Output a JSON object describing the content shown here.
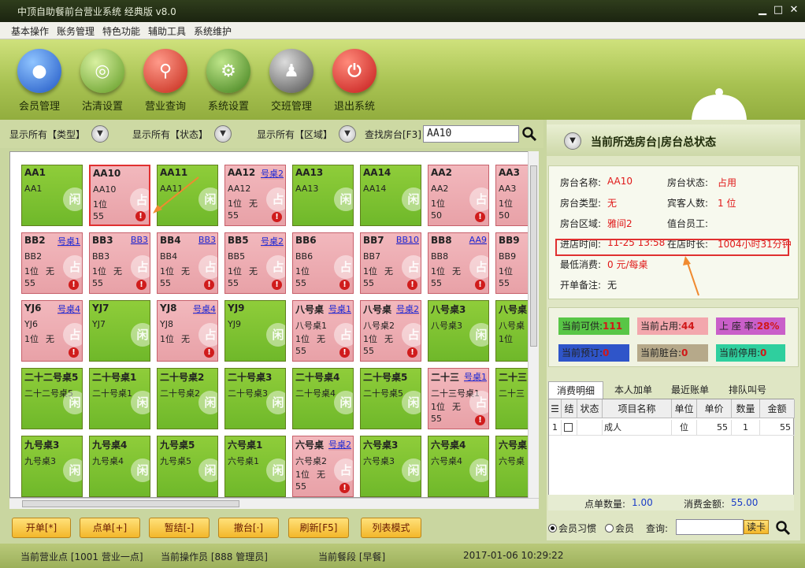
{
  "window": {
    "title": "中顶自助餐前台营业系统 经典版 v8.0"
  },
  "menu": [
    "基本操作",
    "账务管理",
    "特色功能",
    "辅助工具",
    "系统维护"
  ],
  "toolbar": [
    {
      "label": "会员管理",
      "icon": "person-icon",
      "color": "#2f6fd6"
    },
    {
      "label": "沽清设置",
      "icon": "plate-icon",
      "color": "#7db33a"
    },
    {
      "label": "营业查询",
      "icon": "magnifier-icon",
      "color": "#d63a2a"
    },
    {
      "label": "系统设置",
      "icon": "gear-icon",
      "color": "#5a9a2a"
    },
    {
      "label": "交班管理",
      "icon": "people-icon",
      "color": "#6a6a6a"
    },
    {
      "label": "退出系统",
      "icon": "power-icon",
      "color": "#d82a2a"
    }
  ],
  "filters": {
    "type": "显示所有【类型】",
    "status": "显示所有【状态】",
    "area": "显示所有【区域】",
    "search_label": "查找房台[F3]",
    "search_value": "AA10"
  },
  "rows": [
    [
      {
        "name": "AA1",
        "sub": "AA1",
        "state": "free",
        "icon": "闲"
      },
      {
        "name": "AA10",
        "sub": "AA10",
        "state": "busy",
        "people": "1位",
        "amount": "55",
        "icon": "占"
      },
      {
        "name": "AA11",
        "sub": "AA11",
        "state": "free",
        "icon": "闲"
      },
      {
        "name": "AA12",
        "link": "号桌2",
        "sub": "AA12",
        "state": "busy",
        "people": "1位",
        "extra": "无",
        "amount": "55",
        "icon": "占"
      },
      {
        "name": "AA13",
        "sub": "AA13",
        "state": "free",
        "icon": "闲"
      },
      {
        "name": "AA14",
        "sub": "AA14",
        "state": "free",
        "icon": "闲"
      },
      {
        "name": "AA2",
        "sub": "AA2",
        "state": "busy",
        "people": "1位",
        "amount": "50",
        "icon": "占"
      },
      {
        "name": "AA3",
        "sub": "AA3",
        "state": "busy",
        "people": "1位",
        "amount": "50",
        "icon": "占"
      }
    ],
    [
      {
        "name": "BB2",
        "link": "号桌1",
        "sub": "BB2",
        "state": "busy",
        "people": "1位",
        "extra": "无",
        "amount": "55",
        "icon": "占"
      },
      {
        "name": "BB3",
        "link": "BB3",
        "sub": "BB3",
        "state": "busy",
        "people": "1位",
        "extra": "无",
        "amount": "55",
        "icon": "占"
      },
      {
        "name": "BB4",
        "link": "BB3",
        "sub": "BB4",
        "state": "busy",
        "people": "1位",
        "extra": "无",
        "amount": "55",
        "icon": "占"
      },
      {
        "name": "BB5",
        "link": "号桌2",
        "sub": "BB5",
        "state": "busy",
        "people": "1位",
        "extra": "无",
        "amount": "55",
        "icon": "占"
      },
      {
        "name": "BB6",
        "sub": "BB6",
        "state": "busy",
        "people": "1位",
        "amount": "55",
        "icon": "占"
      },
      {
        "name": "BB7",
        "link": "BB10",
        "sub": "BB7",
        "state": "busy",
        "people": "1位",
        "extra": "无",
        "amount": "55",
        "icon": "占"
      },
      {
        "name": "BB8",
        "link": "AA9",
        "sub": "BB8",
        "state": "busy",
        "people": "1位",
        "extra": "无",
        "amount": "55",
        "icon": "占"
      },
      {
        "name": "BB9",
        "sub": "BB9",
        "state": "busy",
        "people": "1位",
        "amount": "55",
        "icon": "占"
      }
    ],
    [
      {
        "name": "YJ6",
        "link": "号桌4",
        "sub": "YJ6",
        "state": "busy",
        "people": "1位",
        "extra": "无",
        "icon": "占"
      },
      {
        "name": "YJ7",
        "sub": "YJ7",
        "state": "free",
        "icon": "闲"
      },
      {
        "name": "YJ8",
        "link": "号桌4",
        "sub": "YJ8",
        "state": "busy",
        "people": "1位",
        "extra": "无",
        "icon": "占"
      },
      {
        "name": "YJ9",
        "sub": "YJ9",
        "state": "free",
        "icon": "闲"
      },
      {
        "name": "八号桌",
        "link": "号桌1",
        "sub": "八号桌1",
        "state": "busy",
        "people": "1位",
        "extra": "无",
        "amount": "55",
        "icon": "占"
      },
      {
        "name": "八号桌",
        "link": "号桌2",
        "sub": "八号桌2",
        "state": "busy",
        "people": "1位",
        "extra": "无",
        "amount": "55",
        "icon": "占"
      },
      {
        "name": "八号桌3",
        "sub": "八号桌3",
        "state": "free",
        "icon": "闲"
      },
      {
        "name": "八号桌",
        "sub": "八号桌",
        "state": "free",
        "people": "1位",
        "icon": "闲"
      }
    ],
    [
      {
        "name": "二十二号桌5",
        "sub": "二十二号桌5",
        "state": "free",
        "icon": "闲"
      },
      {
        "name": "二十号桌1",
        "sub": "二十号桌1",
        "state": "free",
        "icon": "闲"
      },
      {
        "name": "二十号桌2",
        "sub": "二十号桌2",
        "state": "free",
        "icon": "闲"
      },
      {
        "name": "二十号桌3",
        "sub": "二十号桌3",
        "state": "free",
        "icon": "闲"
      },
      {
        "name": "二十号桌4",
        "sub": "二十号桌4",
        "state": "free",
        "icon": "闲"
      },
      {
        "name": "二十号桌5",
        "sub": "二十号桌5",
        "state": "free",
        "icon": "闲"
      },
      {
        "name": "二十三",
        "link": "号桌1",
        "sub": "二十三号桌1",
        "state": "busy",
        "people": "1位",
        "extra": "无",
        "amount": "55",
        "icon": "占"
      },
      {
        "name": "二十三",
        "sub": "二十三",
        "state": "free",
        "icon": "闲"
      }
    ],
    [
      {
        "name": "九号桌3",
        "sub": "九号桌3",
        "state": "free",
        "icon": "闲"
      },
      {
        "name": "九号桌4",
        "sub": "九号桌4",
        "state": "free",
        "icon": "闲"
      },
      {
        "name": "九号桌5",
        "sub": "九号桌5",
        "state": "free",
        "icon": "闲"
      },
      {
        "name": "六号桌1",
        "sub": "六号桌1",
        "state": "free",
        "icon": "闲"
      },
      {
        "name": "六号桌",
        "link": "号桌2",
        "sub": "六号桌2",
        "state": "busy",
        "people": "1位",
        "extra": "无",
        "amount": "55",
        "icon": "占"
      },
      {
        "name": "六号桌3",
        "sub": "六号桌3",
        "state": "free",
        "icon": "闲"
      },
      {
        "name": "六号桌4",
        "sub": "六号桌4",
        "state": "free",
        "icon": "闲"
      },
      {
        "name": "六号桌",
        "sub": "六号桌",
        "state": "free",
        "icon": "闲"
      }
    ]
  ],
  "bottom_buttons": [
    "开单[*]",
    "点单[+]",
    "暂结[-]",
    "撤台[·]",
    "刷新[F5]",
    "列表模式"
  ],
  "status": {
    "point": "当前营业点 [1001 营业一点]",
    "operator": "当前操作员 [888 管理员]",
    "period": "当前餐段 [早餐]",
    "datetime": "2017-01-06 10:29:22"
  },
  "panel": {
    "title": "当前所选房台|房台总状态",
    "labels": {
      "room_name": "房台名称:",
      "room_status": "房台状态:",
      "room_type": "房台类型:",
      "guests": "宾客人数:",
      "room_area": "房台区域:",
      "staff": "值台员工:",
      "entry_time": "进店时间:",
      "duration": "在店时长:",
      "min_consume": "最低消费:",
      "remark": "开单备注:"
    },
    "values": {
      "room_name": "AA10",
      "room_status": "占用",
      "room_type": "无",
      "guests": "1 位",
      "room_area": "雅间2",
      "entry_time": "11-25 13:58",
      "duration": "1004小时31分钟",
      "min_consume": "0 元/每桌",
      "remark": "无"
    },
    "stats": [
      {
        "label": "当前可供:",
        "value": "111",
        "bg": "#58c646"
      },
      {
        "label": "当前占用:",
        "value": "44",
        "bg": "#f3a7ad"
      },
      {
        "label": "上 座 率:",
        "value": "28%",
        "bg": "#c95fc9"
      },
      {
        "label": "当前预订:",
        "value": "0",
        "bg": "#2f55c9"
      },
      {
        "label": "当前脏台:",
        "value": "0",
        "bg": "#b6a98a"
      },
      {
        "label": "当前停用:",
        "value": "0",
        "bg": "#2fcf9e"
      }
    ],
    "tabs": [
      "消费明细",
      "本人加单",
      "最近账单",
      "排队叫号"
    ],
    "table_headers": [
      "结",
      "状态",
      "项目名称",
      "单位",
      "单价",
      "数量",
      "金额"
    ],
    "table_row": {
      "no": "1",
      "item": "成人",
      "unit": "位",
      "price": "55",
      "qty": "1",
      "amount": "55"
    },
    "summary": {
      "count_label": "点单数量:",
      "count": "1.00",
      "amount_label": "消费金额:",
      "amount": "55.00"
    },
    "member": {
      "opt1": "会员习惯",
      "opt2": "会员",
      "query_label": "查询:",
      "read_card": "读卡"
    }
  }
}
